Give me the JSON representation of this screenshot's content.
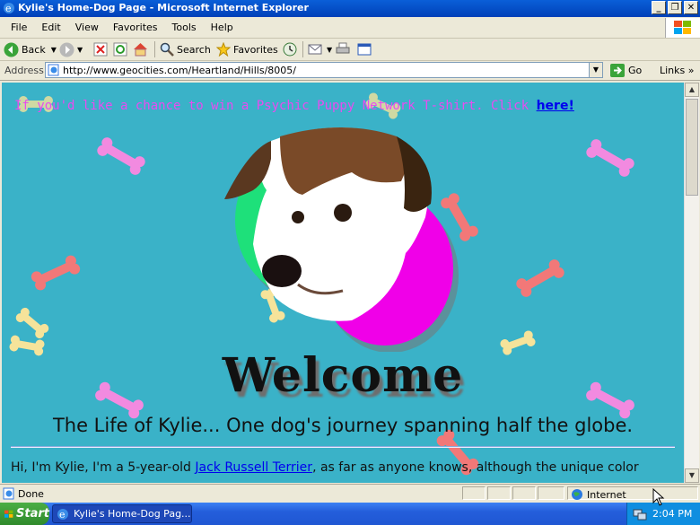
{
  "window": {
    "title": "Kylie's Home-Dog Page - Microsoft Internet Explorer"
  },
  "menu": [
    "File",
    "Edit",
    "View",
    "Favorites",
    "Tools",
    "Help"
  ],
  "toolbar": {
    "back": "Back",
    "search": "Search",
    "favorites": "Favorites"
  },
  "address": {
    "label": "Address",
    "url": "http://www.geocities.com/Heartland/Hills/8005/",
    "go": "Go",
    "links": "Links"
  },
  "page": {
    "promo_text": "If you'd like a chance to win a Psychic Puppy Network T-shirt. Click",
    "promo_link": "here!",
    "welcome": "Welcome",
    "subtitle": "The Life of Kylie... One dog's journey spanning half the globe.",
    "para_start": "Hi, I'm Kylie, I'm a 5-year-old",
    "para_link": "Jack Russell Terrier",
    "para_end": ", as far as anyone knows, although the unique color"
  },
  "status": {
    "text": "Done",
    "zone": "Internet"
  },
  "taskbar": {
    "start": "Start",
    "task": "Kylie's Home-Dog Pag...",
    "clock": "2:04 PM"
  },
  "colors": {
    "page_bg": "#3ab2c8",
    "promo": "#e84cf0",
    "title_bar": "#0a5fd8"
  }
}
